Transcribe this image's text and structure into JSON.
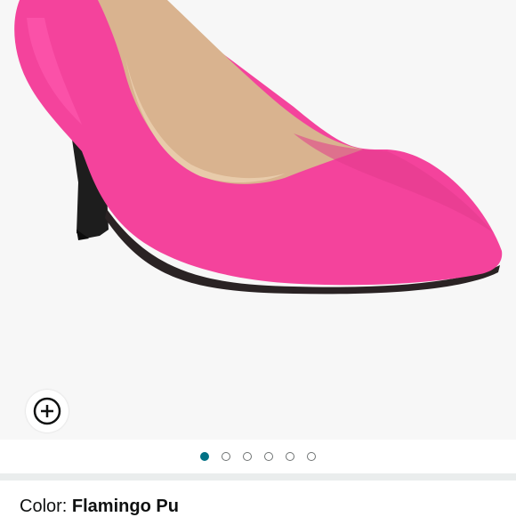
{
  "product": {
    "image_alt": "Flamingo pink pointed-toe pump",
    "image_count": 6,
    "active_image_index": 0
  },
  "zoom": {
    "icon": "zoom-in-icon"
  },
  "variation": {
    "color_label": "Color: ",
    "color_value": "Flamingo Pu"
  },
  "colors": {
    "accent": "#007185",
    "shoe": "#f4439c",
    "background": "#f7f7f7",
    "separator": "#eaeded",
    "text": "#0f1111"
  }
}
